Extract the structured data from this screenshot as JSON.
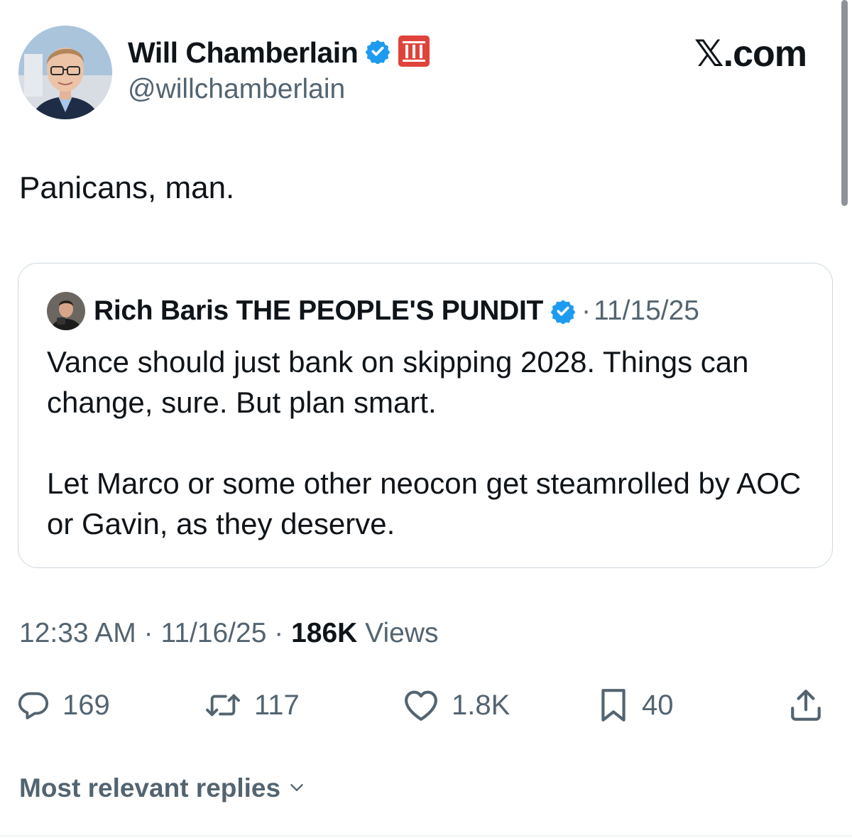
{
  "author": {
    "display_name": "Will Chamberlain",
    "handle": "@willchamberlain",
    "verified": true,
    "badge_icon": "affiliate-badge-icon",
    "avatar_icon": "profile-photo"
  },
  "site_label": "𝕏.com",
  "tweet": {
    "text": "Panicans, man."
  },
  "quote": {
    "display_name": "Rich Baris THE PEOPLE'S PUNDIT",
    "verified": true,
    "separator": "·",
    "date": "11/15/25",
    "text": "Vance should just bank on skipping 2028. Things can change, sure. But plan smart.\n\nLet Marco or some other neocon get steamrolled by AOC or Gavin, as they deserve."
  },
  "meta": {
    "time": "12:33 AM",
    "date": "11/16/25",
    "separator": "·",
    "views_count": "186K",
    "views_label": "Views"
  },
  "actions": {
    "replies": "169",
    "reposts": "117",
    "likes": "1.8K",
    "bookmarks": "40"
  },
  "replies_sort": {
    "label": "Most relevant replies"
  },
  "colors": {
    "text_primary": "#0f1419",
    "text_secondary": "#536471",
    "verified_blue": "#1d9bf0",
    "border": "#cfd9de",
    "badge_red": "#e0433b"
  }
}
